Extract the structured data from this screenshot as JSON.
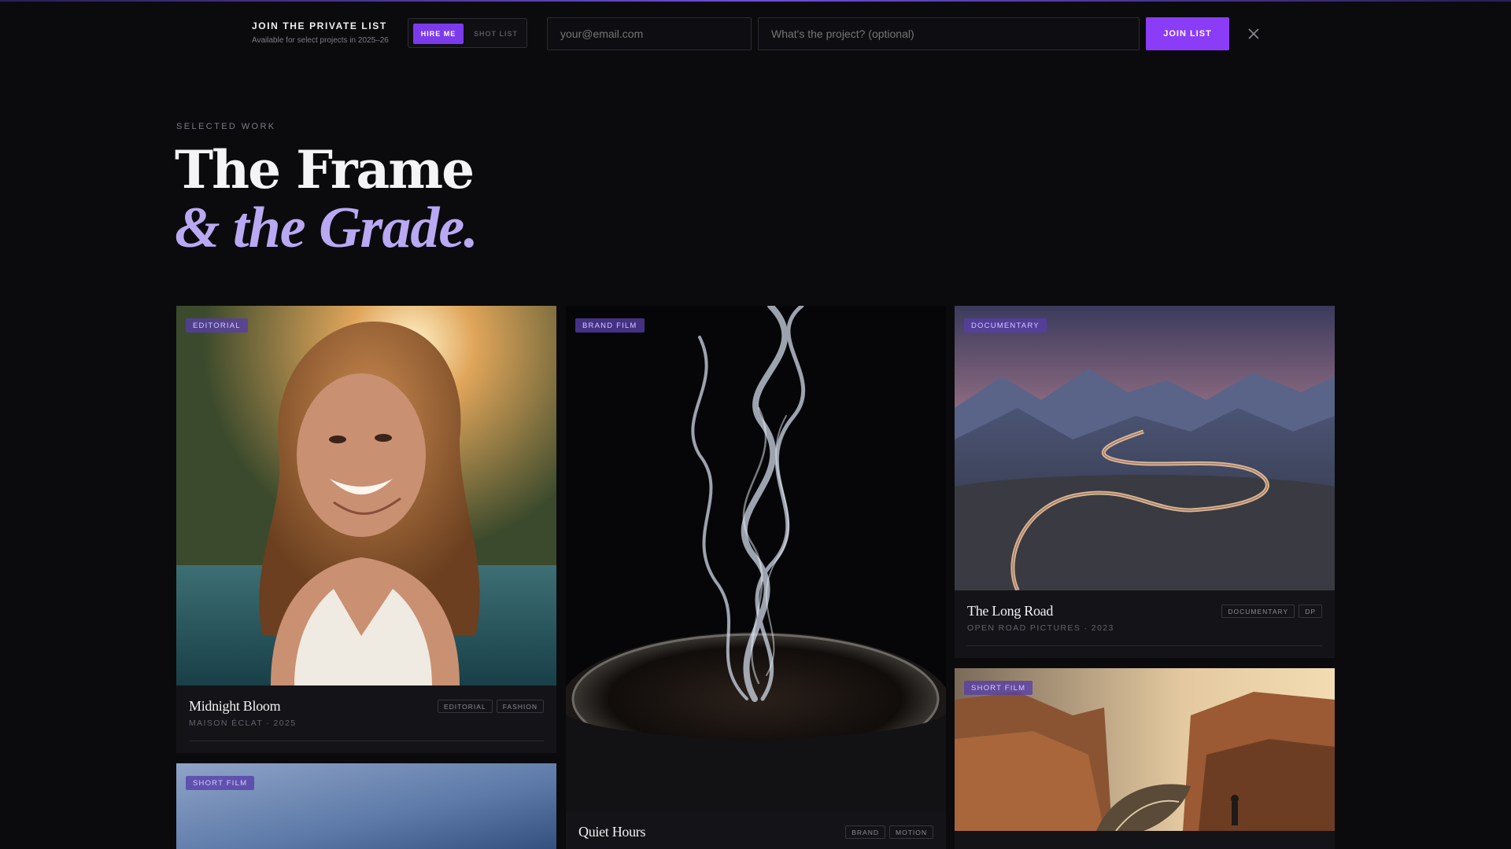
{
  "banner": {
    "title": "JOIN THE PRIVATE LIST",
    "subtitle": "Available for select projects in 2025–26",
    "toggle": {
      "active": "HIRE ME",
      "inactive": "SHOT LIST"
    },
    "email_placeholder": "your@email.com",
    "project_placeholder": "What's the project? (optional)",
    "join_label": "JOIN LIST",
    "close_icon": "close-icon"
  },
  "hero": {
    "eyebrow": "SELECTED WORK",
    "title_line1": "The Frame",
    "title_line2": "& the Grade."
  },
  "cards": [
    {
      "badge": "EDITORIAL",
      "title": "Midnight Bloom",
      "meta": "MAISON ÉCLAT · 2025",
      "tags": [
        "EDITORIAL",
        "FASHION"
      ]
    },
    {
      "badge": "BRAND FILM",
      "title": "Quiet Hours",
      "meta": "",
      "tags": [
        "BRAND",
        "MOTION"
      ]
    },
    {
      "badge": "DOCUMENTARY",
      "title": "The Long Road",
      "meta": "OPEN ROAD PICTURES · 2023",
      "tags": [
        "DOCUMENTARY",
        "DP"
      ]
    },
    {
      "badge": "SHORT FILM",
      "title": "",
      "meta": "",
      "tags": []
    },
    {
      "badge": "SHORT FILM",
      "title": "",
      "meta": "",
      "tags": []
    }
  ],
  "colors": {
    "accent": "#8b3cf7",
    "accent_light": "#b9a9f2",
    "background": "#0b0b0e"
  }
}
